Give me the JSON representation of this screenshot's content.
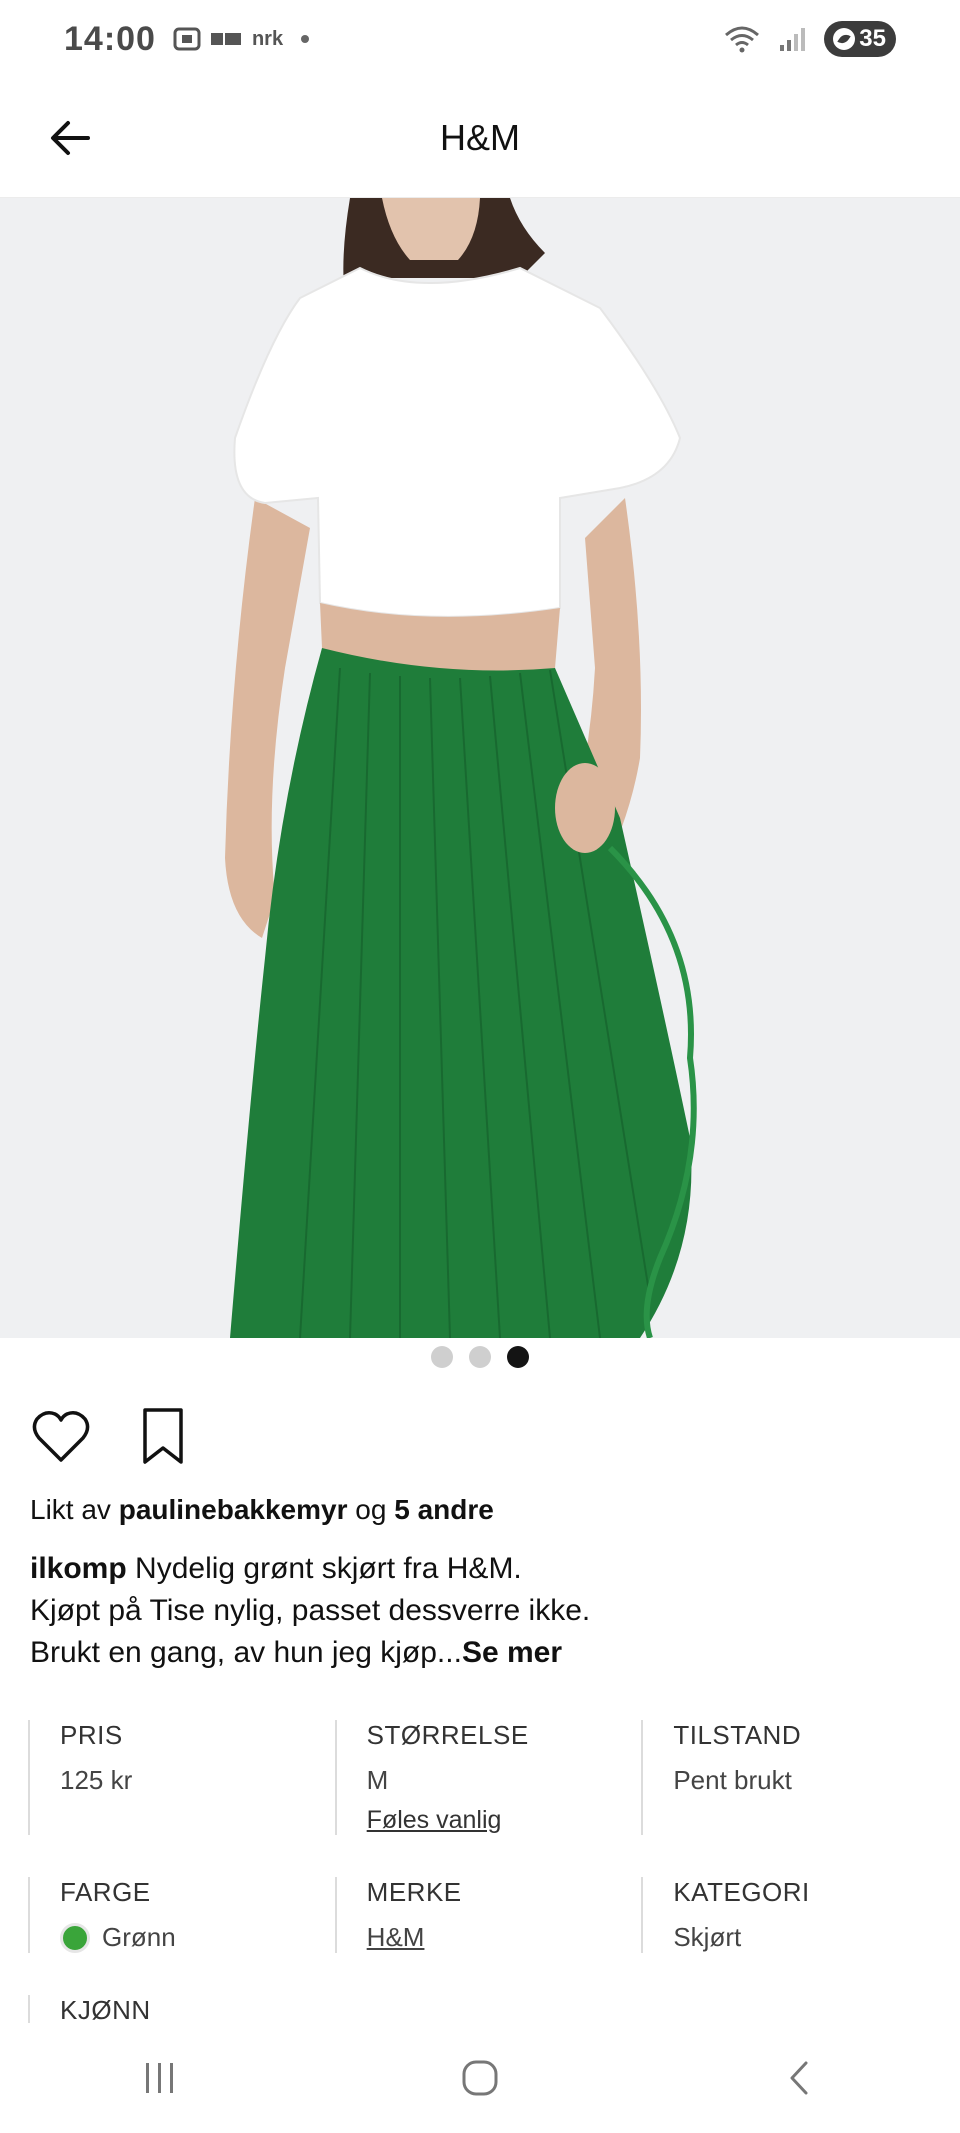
{
  "status": {
    "time": "14:00",
    "mini_label": "nrk",
    "battery": "35"
  },
  "header": {
    "title": "H&M"
  },
  "image": {
    "alt": "Model wearing white t-shirt and green pleated skirt"
  },
  "carousel": {
    "active_index": 3,
    "count": 3
  },
  "likes": {
    "prefix": "Likt av",
    "user": "paulinebakkemyr",
    "middle": "og",
    "others": "5 andre"
  },
  "caption": {
    "user": "ilkomp",
    "line1": "Nydelig grønt skjørt fra H&M.",
    "line2": "Kjøpt på Tise nylig, passet dessverre ikke.",
    "line3": "Brukt en gang, av hun jeg kjøp...",
    "more": "Se mer"
  },
  "attributes": {
    "price": {
      "label": "PRIS",
      "value": "125 kr"
    },
    "size": {
      "label": "STØRRELSE",
      "value": "M",
      "note": "Føles vanlig"
    },
    "condition": {
      "label": "TILSTAND",
      "value": "Pent brukt"
    },
    "color": {
      "label": "FARGE",
      "value": "Grønn",
      "hex": "#3aa53a"
    },
    "brand": {
      "label": "MERKE",
      "value": "H&M"
    },
    "category": {
      "label": "KATEGORI",
      "value": "Skjørt"
    },
    "gender": {
      "label": "KJØNN"
    }
  },
  "colors": {
    "skirt": "#1f7d3a",
    "background": "#eff0f2",
    "dot_active": "#141414",
    "dot_inactive": "#cfcfcf"
  }
}
